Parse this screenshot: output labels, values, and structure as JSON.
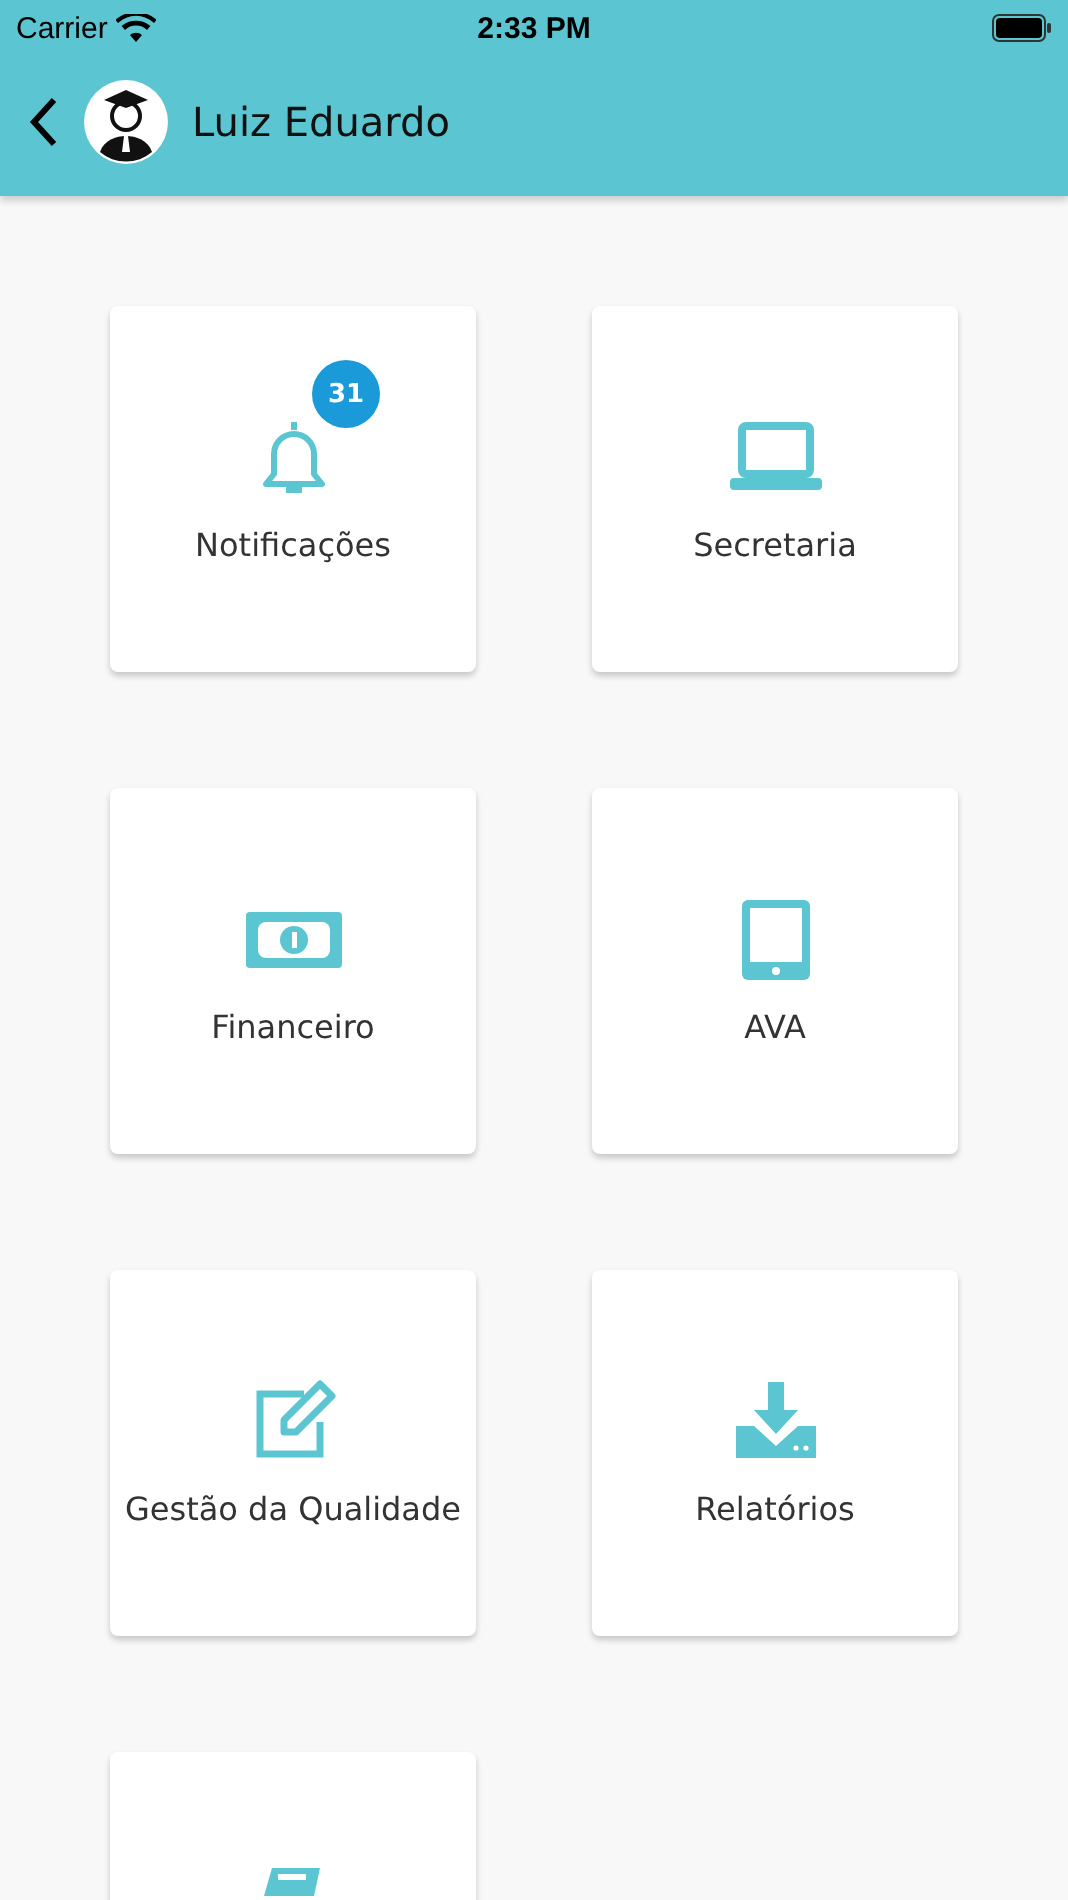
{
  "status_bar": {
    "carrier": "Carrier",
    "time": "2:33 PM"
  },
  "header": {
    "title": "Luiz Eduardo"
  },
  "tiles": [
    {
      "kind": "bell",
      "label": "Notificações",
      "badge": "31"
    },
    {
      "kind": "laptop",
      "label": "Secretaria"
    },
    {
      "kind": "money",
      "label": "Financeiro"
    },
    {
      "kind": "tablet",
      "label": "AVA"
    },
    {
      "kind": "edit",
      "label": "Gestão da Qualidade"
    },
    {
      "kind": "download",
      "label": "Relatórios"
    },
    {
      "kind": "book"
    }
  ]
}
